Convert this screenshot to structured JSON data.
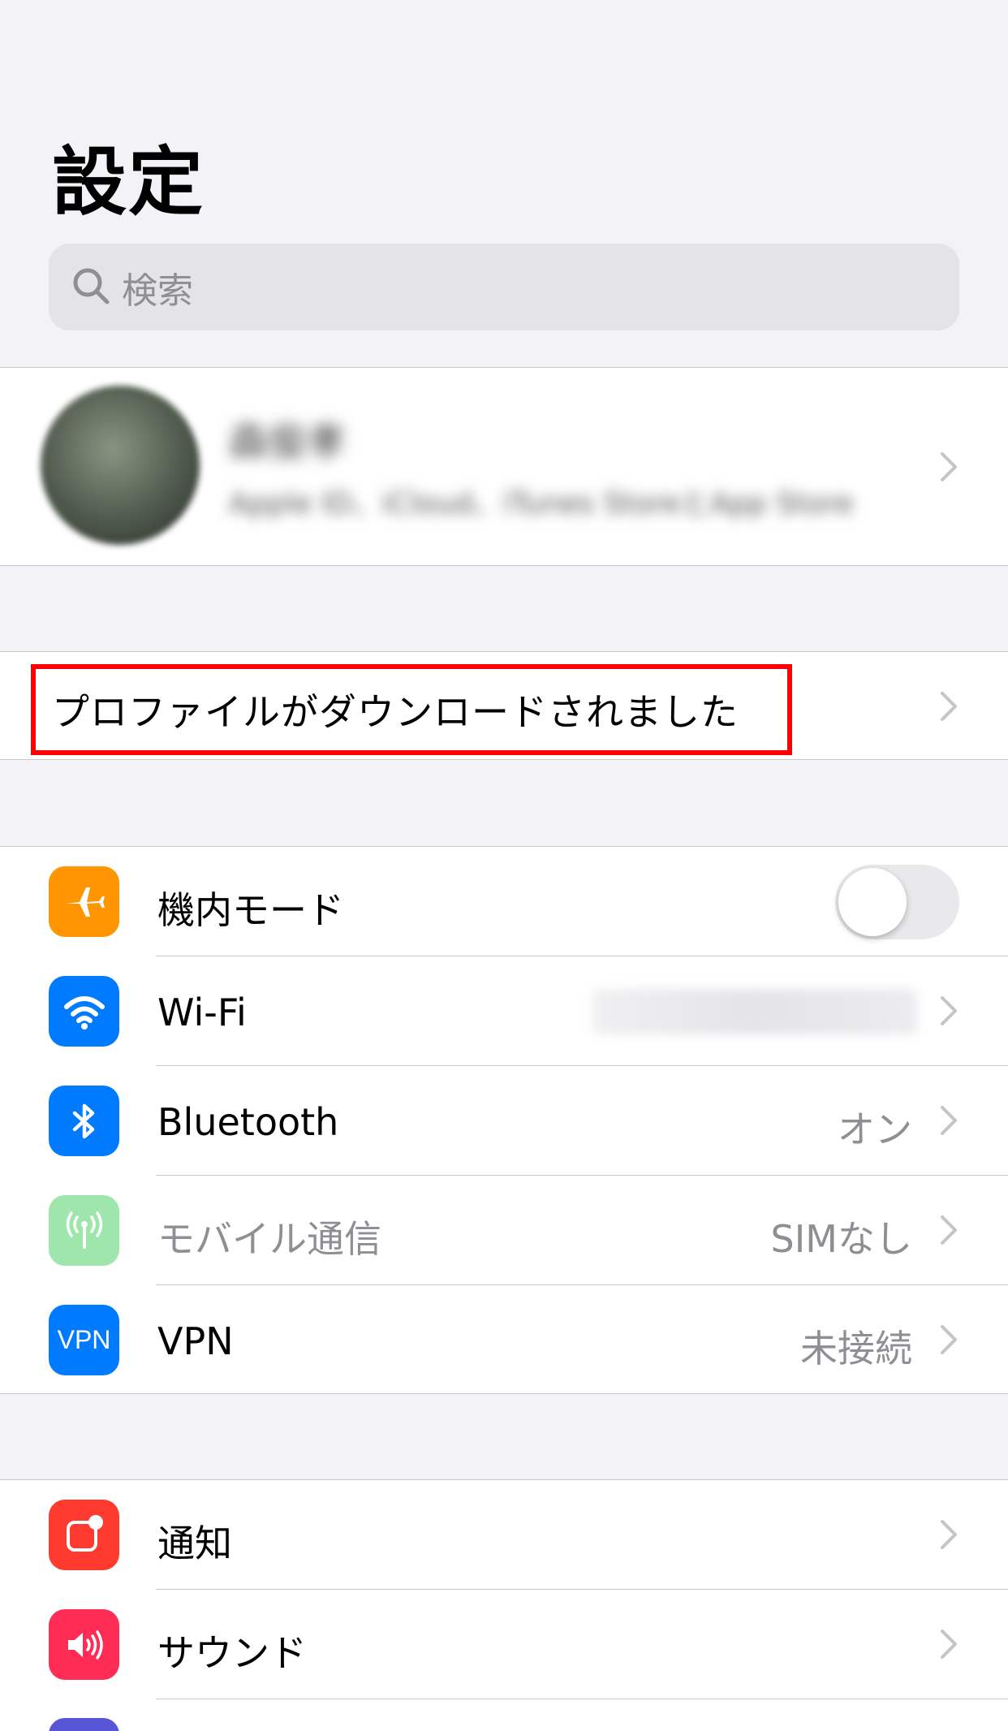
{
  "header": {
    "title": "設定"
  },
  "search": {
    "placeholder": "検索"
  },
  "profile": {
    "name": "森俊孝",
    "subtitle": "Apple ID、iCloud、iTunes StoreとApp Store"
  },
  "notice": {
    "label": "プロファイルがダウンロードされました"
  },
  "network": {
    "airplane": {
      "label": "機内モード",
      "icon": "airplane-icon",
      "color": "#ff9500",
      "on": false
    },
    "wifi": {
      "label": "Wi-Fi",
      "icon": "wifi-icon",
      "color": "#007aff"
    },
    "bluetooth": {
      "label": "Bluetooth",
      "value": "オン",
      "icon": "bluetooth-icon",
      "color": "#007aff"
    },
    "mobile": {
      "label": "モバイル通信",
      "value": "SIMなし",
      "icon": "antenna-icon",
      "color": "#9ee6ab"
    },
    "vpn": {
      "label": "VPN",
      "value": "未接続",
      "icon_text": "VPN",
      "color": "#007aff"
    }
  },
  "notifications": {
    "notify": {
      "label": "通知",
      "icon": "notification-icon",
      "color": "#ff3b30"
    },
    "sound": {
      "label": "サウンド",
      "icon": "speaker-icon",
      "color": "#ff2d55"
    }
  }
}
